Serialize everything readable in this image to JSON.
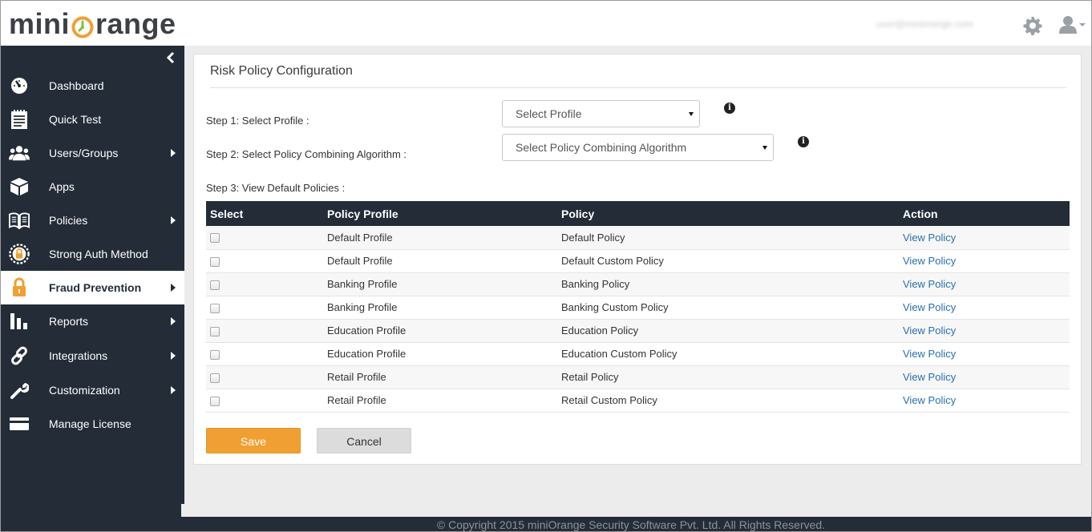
{
  "header": {
    "brand_prefix": "mini",
    "brand_suffix": "range",
    "user_email": "user@miniorange.com"
  },
  "sidebar": {
    "items": [
      {
        "label": "Dashboard",
        "icon": "dashboard-icon",
        "has_submenu": false,
        "active": false
      },
      {
        "label": "Quick Test",
        "icon": "notepad-icon",
        "has_submenu": false,
        "active": false
      },
      {
        "label": "Users/Groups",
        "icon": "users-icon",
        "has_submenu": true,
        "active": false
      },
      {
        "label": "Apps",
        "icon": "cube-icon",
        "has_submenu": false,
        "active": false
      },
      {
        "label": "Policies",
        "icon": "book-icon",
        "has_submenu": true,
        "active": false
      },
      {
        "label": "Strong Auth Method",
        "icon": "lock-badge-icon",
        "has_submenu": false,
        "active": false
      },
      {
        "label": "Fraud Prevention",
        "icon": "padlock-icon",
        "has_submenu": true,
        "active": true
      },
      {
        "label": "Reports",
        "icon": "bar-chart-icon",
        "has_submenu": true,
        "active": false
      },
      {
        "label": "Integrations",
        "icon": "link-icon",
        "has_submenu": true,
        "active": false
      },
      {
        "label": "Customization",
        "icon": "wrench-icon",
        "has_submenu": true,
        "active": false
      },
      {
        "label": "Manage License",
        "icon": "card-icon",
        "has_submenu": false,
        "active": false
      }
    ]
  },
  "main": {
    "title": "Risk Policy Configuration",
    "step1_label": "Step 1: Select Profile :",
    "step1_select": "Select Profile",
    "step2_label": "Step 2: Select Policy Combining Algorithm :",
    "step2_select": "Select Policy Combining Algorithm",
    "step3_label": "Step 3: View Default Policies :",
    "table": {
      "headers": [
        "Select",
        "Policy Profile",
        "Policy",
        "Action"
      ],
      "rows": [
        {
          "profile": "Default Profile",
          "policy": "Default Policy",
          "action": "View Policy"
        },
        {
          "profile": "Default Profile",
          "policy": "Default Custom Policy",
          "action": "View Policy"
        },
        {
          "profile": "Banking Profile",
          "policy": "Banking Policy",
          "action": "View Policy"
        },
        {
          "profile": "Banking Profile",
          "policy": "Banking Custom Policy",
          "action": "View Policy"
        },
        {
          "profile": "Education Profile",
          "policy": "Education Policy",
          "action": "View Policy"
        },
        {
          "profile": "Education Profile",
          "policy": "Education Custom Policy",
          "action": "View Policy"
        },
        {
          "profile": "Retail Profile",
          "policy": "Retail Policy",
          "action": "View Policy"
        },
        {
          "profile": "Retail Profile",
          "policy": "Retail Custom Policy",
          "action": "View Policy"
        }
      ]
    },
    "save_label": "Save",
    "cancel_label": "Cancel"
  },
  "footer": {
    "copyright": "© Copyright 2015 miniOrange Security Software Pvt. Ltd. All Rights Reserved."
  },
  "colors": {
    "sidebar_bg": "#232c37",
    "accent_orange": "#f0a032",
    "link_blue": "#2a6fb0"
  }
}
